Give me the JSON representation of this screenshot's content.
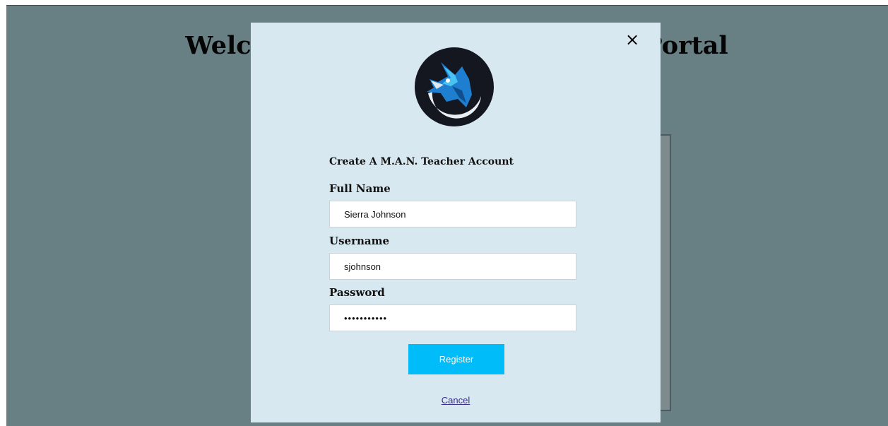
{
  "page": {
    "heading": "Welcome to the M.A.N. Learning Portal"
  },
  "modal": {
    "close_icon": "×",
    "logo_icon": "wolf-logo-icon",
    "title": "Create A M.A.N. Teacher Account",
    "fields": {
      "full_name": {
        "label": "Full Name",
        "value": "Sierra Johnson"
      },
      "username": {
        "label": "Username",
        "value": "sjohnson"
      },
      "password": {
        "label": "Password",
        "value": "•••••••••••"
      }
    },
    "register_label": "Register",
    "cancel_label": "Cancel"
  },
  "colors": {
    "backdrop": "#687f84",
    "modal_background": "#d8e8f1",
    "accent": "#00bcf9",
    "link": "#3b2f86"
  }
}
